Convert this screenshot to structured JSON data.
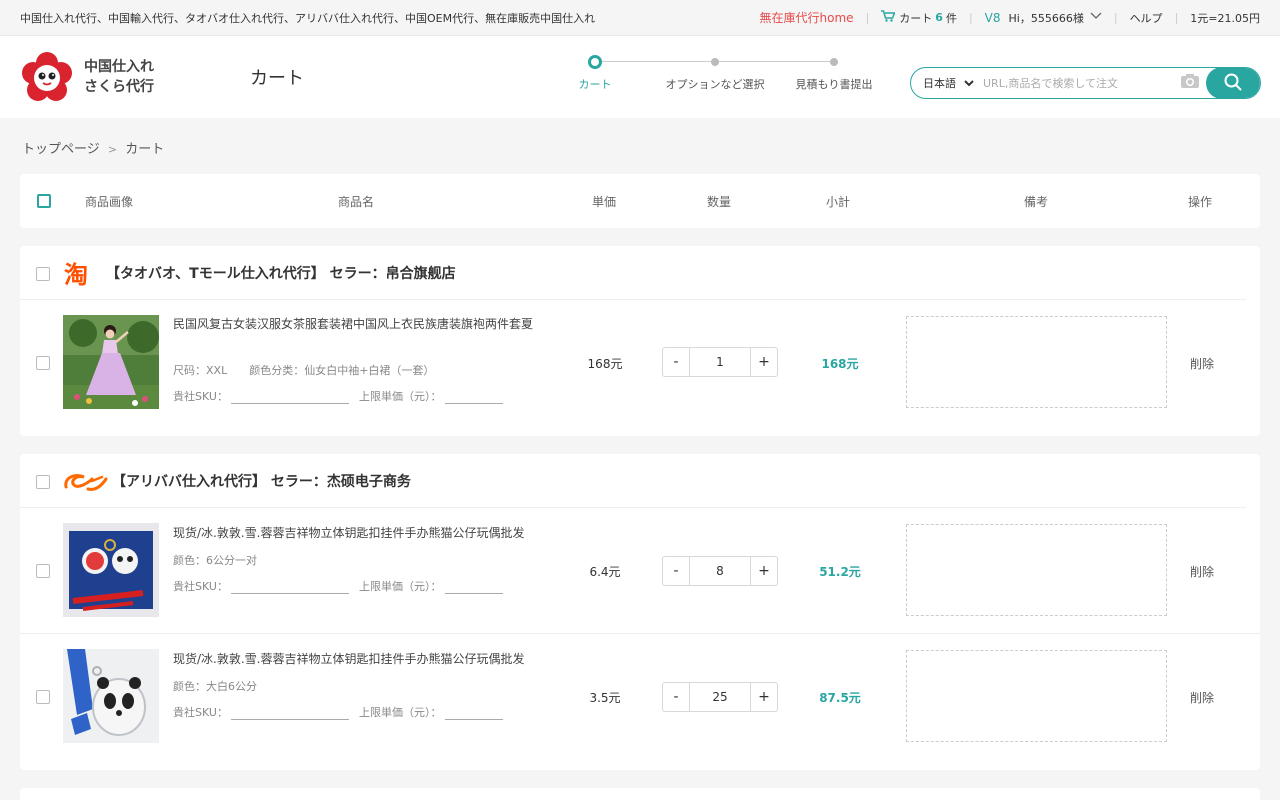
{
  "topbar": {
    "services": "中国仕入れ代行、中国輸入代行、タオバオ仕入れ代行、アリババ仕入れ代行、中国OEM代行、無在庫販売中国仕入れ",
    "home_link": "無在庫代行home",
    "cart_label": "カート",
    "cart_count": "6",
    "cart_unit": "件",
    "vip_level": "V8",
    "greeting": "Hi，555666様",
    "help": "ヘルプ",
    "rate": "1元=21.05円"
  },
  "header": {
    "logo_line1": "中国仕入れ",
    "logo_line2": "さくら代行",
    "page_title": "カート",
    "steps": [
      "カート",
      "オプションなど選択",
      "見積もり書提出"
    ],
    "search_lang": "日本語",
    "search_placeholder": "URL,商品名で検索して注文"
  },
  "breadcrumb": {
    "home": "トップページ",
    "sep": ">",
    "current": "カート"
  },
  "columns": {
    "image": "商品画像",
    "name": "商品名",
    "price": "単価",
    "qty": "数量",
    "subtotal": "小計",
    "note": "備考",
    "action": "操作"
  },
  "sellers": [
    {
      "platform": "taobao",
      "logo_text": "淘",
      "title": "【タオバオ、Tモール仕入れ代行】 セラー：帛合旗舰店",
      "items": [
        {
          "name": "民国风复古女装汉服女茶服套装裙中国风上衣民族唐装旗袍两件套夏",
          "option": "尺码：XXL　　颜色分类：仙女白中袖+白裙（一套）",
          "sku_label": "貴社SKU：",
          "limit_label": "上限単価（元）：",
          "price": "168元",
          "qty": "1",
          "subtotal": "168元",
          "delete": "削除"
        }
      ]
    },
    {
      "platform": "alibaba",
      "title": "【アリババ仕入れ代行】 セラー：杰硕电子商务",
      "items": [
        {
          "name": "现货/冰.敦敦.雪.蓉蓉吉祥物立体钥匙扣挂件手办熊猫公仔玩偶批发",
          "option": "颜色：6公分一对",
          "sku_label": "貴社SKU：",
          "limit_label": "上限単価（元）：",
          "price": "6.4元",
          "qty": "8",
          "subtotal": "51.2元",
          "delete": "削除"
        },
        {
          "name": "现货/冰.敦敦.雪.蓉蓉吉祥物立体钥匙扣挂件手办熊猫公仔玩偶批发",
          "option": "颜色：大白6公分",
          "sku_label": "貴社SKU：",
          "limit_label": "上限単価（元）：",
          "price": "3.5元",
          "qty": "25",
          "subtotal": "87.5元",
          "delete": "削除"
        }
      ]
    }
  ],
  "qty_minus": "-",
  "qty_plus": "+",
  "colors": {
    "accent": "#2aa6a1",
    "red": "#e84a4a",
    "taobao": "#ff5000",
    "alibaba": "#ff6a00"
  }
}
